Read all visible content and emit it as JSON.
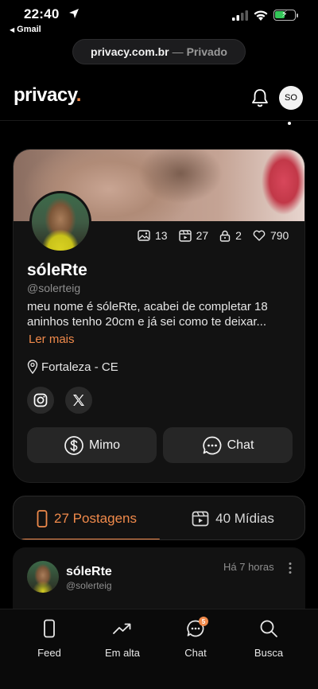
{
  "status_bar": {
    "time": "22:40",
    "back_app": "Gmail"
  },
  "browser": {
    "domain": "privacy.com.br",
    "separator": "—",
    "mode": "Privado"
  },
  "header": {
    "logo": "privacy",
    "logo_dot": ".",
    "avatar_initials": "SO"
  },
  "profile": {
    "stats": {
      "photos": "13",
      "videos": "27",
      "locked": "2",
      "likes": "790"
    },
    "name": "sóleRte",
    "handle": "@solerteig",
    "bio": "meu nome é sóleRte, acabei de completar 18 aninhos tenho 20cm e já sei como te deixar...",
    "read_more": "Ler mais",
    "location": "Fortaleza - CE",
    "mimo_label": "Mimo",
    "chat_label": "Chat"
  },
  "tabs": {
    "posts_label": "27 Postagens",
    "media_label": "40 Mídias"
  },
  "post": {
    "name": "sóleRte",
    "handle": "@solerteig",
    "time": "Há 7 horas"
  },
  "bottom_nav": {
    "feed": "Feed",
    "trending": "Em alta",
    "chat": "Chat",
    "chat_badge": "5",
    "search": "Busca"
  },
  "colors": {
    "accent": "#f08a4b",
    "background": "#000000",
    "card": "#121212"
  }
}
